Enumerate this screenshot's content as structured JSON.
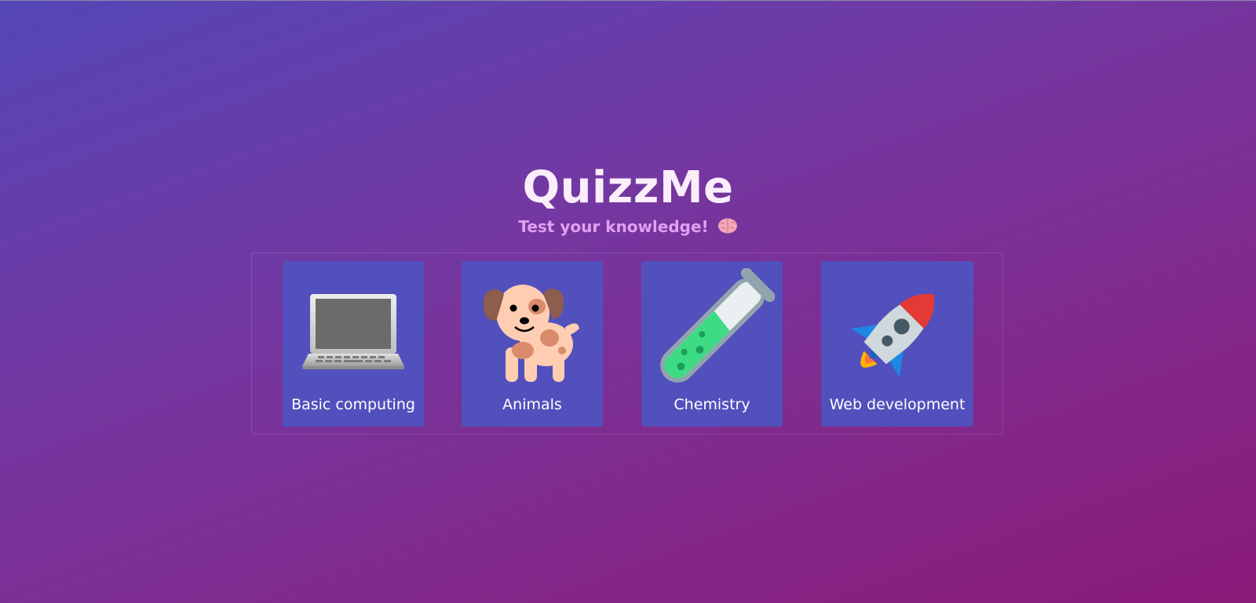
{
  "header": {
    "title": "QuizzMe",
    "subtitle": "Test your knowledge!",
    "subtitle_icon": "brain-icon"
  },
  "categories": [
    {
      "label": "Basic computing",
      "icon": "laptop-icon"
    },
    {
      "label": "Animals",
      "icon": "dog-icon"
    },
    {
      "label": "Chemistry",
      "icon": "test-tube-icon"
    },
    {
      "label": "Web development",
      "icon": "rocket-icon"
    }
  ],
  "colors": {
    "card_background": "#5250bc",
    "subtitle": "#e1a0f1",
    "title": "#fbeefa"
  }
}
